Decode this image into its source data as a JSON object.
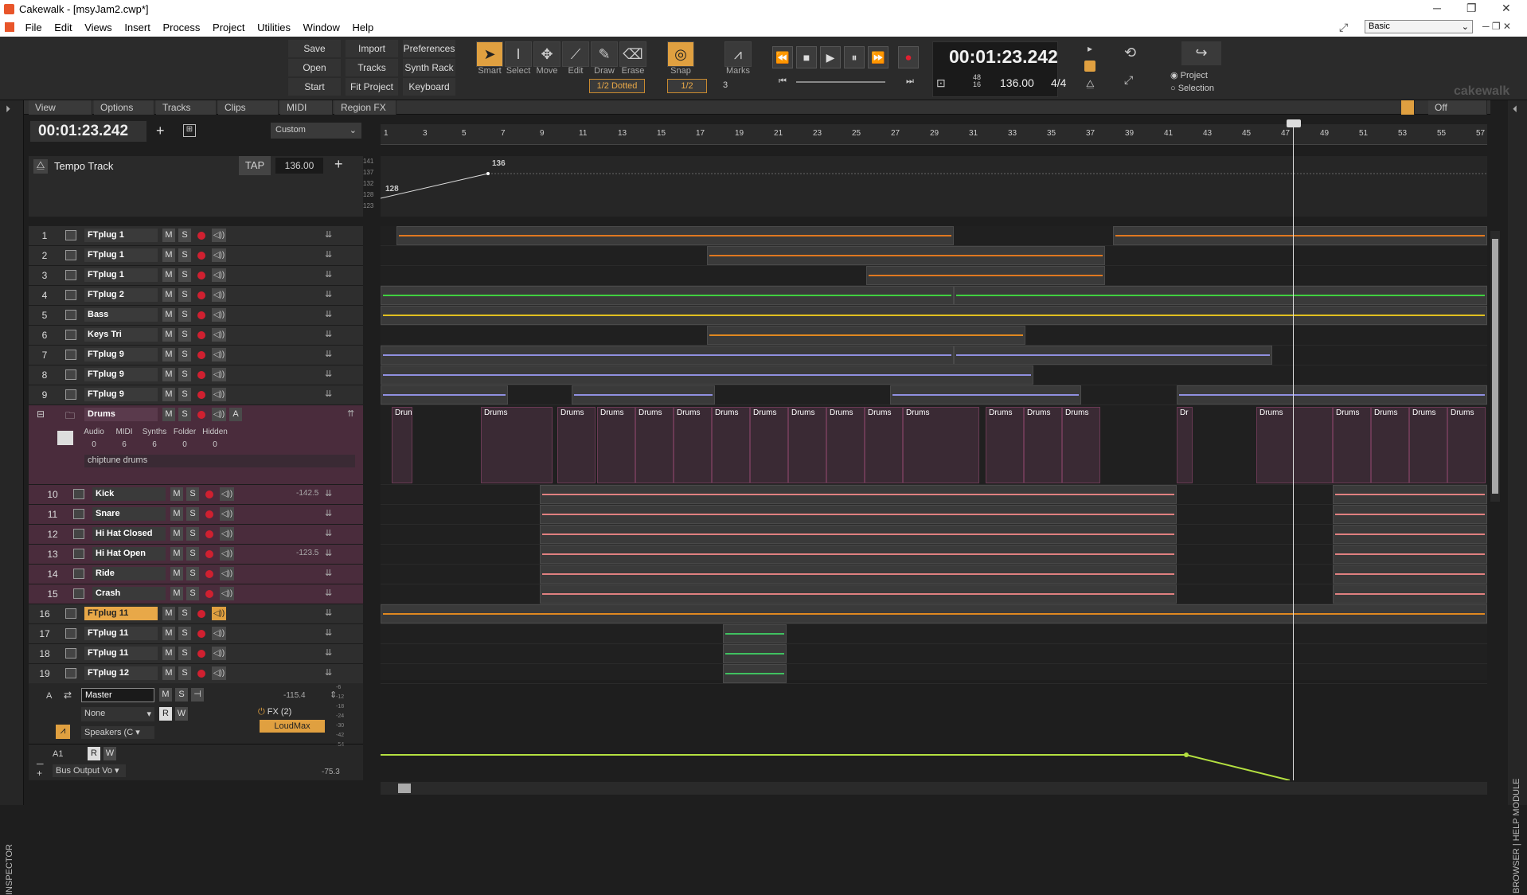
{
  "window": {
    "title": "Cakewalk - [msyJam2.cwp*]"
  },
  "menu": [
    "File",
    "Edit",
    "Views",
    "Insert",
    "Process",
    "Project",
    "Utilities",
    "Window",
    "Help"
  ],
  "workspace": "Basic",
  "control_bar": {
    "buttons": [
      "Save",
      "Import",
      "Preferences",
      "Open",
      "Tracks",
      "Synth Rack",
      "Start Screen",
      "Fit Project",
      "Keyboard"
    ],
    "tools": [
      "Smart",
      "Select",
      "Move",
      "Edit",
      "Draw",
      "Erase"
    ],
    "snap_label": "Snap",
    "snap_value": "1/2 Dotted",
    "marks_label": "Marks",
    "snap2_value": "1/2",
    "snap2_count": "3",
    "time": "00:01:23.242",
    "tempo": "136.00",
    "meter": "4/4",
    "ts_top": "48",
    "ts_bottom": "16",
    "project_opt": "Project",
    "selection_opt": "Selection"
  },
  "track_menu": [
    "View",
    "Options",
    "Tracks",
    "Clips",
    "MIDI",
    "Region FX"
  ],
  "region_off": "Off",
  "now_time": "00:01:23.242",
  "custom": "Custom",
  "tempo_track": {
    "label": "Tempo Track",
    "tap": "TAP",
    "value": "136.00",
    "start_val": "128",
    "end_val": "136",
    "scale": [
      "141",
      "137",
      "132",
      "128",
      "123"
    ]
  },
  "ruler": [
    "1",
    "3",
    "5",
    "7",
    "9",
    "11",
    "13",
    "15",
    "17",
    "19",
    "21",
    "23",
    "25",
    "27",
    "29",
    "31",
    "33",
    "35",
    "37",
    "39",
    "41",
    "43",
    "45",
    "47",
    "49",
    "51",
    "53",
    "55",
    "57"
  ],
  "tracks": [
    {
      "num": "1",
      "name": "FTplug 1"
    },
    {
      "num": "2",
      "name": "FTplug 1"
    },
    {
      "num": "3",
      "name": "FTplug 1"
    },
    {
      "num": "4",
      "name": "FTplug 2"
    },
    {
      "num": "5",
      "name": "Bass"
    },
    {
      "num": "6",
      "name": "Keys Tri"
    },
    {
      "num": "7",
      "name": "FTplug 9"
    },
    {
      "num": "8",
      "name": "FTplug 9"
    },
    {
      "num": "9",
      "name": "FTplug 9"
    }
  ],
  "folder": {
    "name": "Drums",
    "cols": [
      "Audio",
      "MIDI",
      "Synths",
      "Folder",
      "Hidden"
    ],
    "vals": [
      "0",
      "6",
      "6",
      "0",
      "0"
    ],
    "desc": "chiptune drums",
    "clip": "Drums",
    "clip_short": "Drun",
    "clip_dr": "Dr"
  },
  "drum_tracks": [
    {
      "num": "10",
      "name": "Kick",
      "vol": "-142.5"
    },
    {
      "num": "11",
      "name": "Snare",
      "vol": ""
    },
    {
      "num": "12",
      "name": "Hi Hat Closed",
      "vol": ""
    },
    {
      "num": "13",
      "name": "Hi Hat Open",
      "vol": "-123.5"
    },
    {
      "num": "14",
      "name": "Ride",
      "vol": ""
    },
    {
      "num": "15",
      "name": "Crash",
      "vol": ""
    }
  ],
  "tracks2": [
    {
      "num": "16",
      "name": "FTplug 11"
    },
    {
      "num": "17",
      "name": "FTplug 11"
    },
    {
      "num": "18",
      "name": "FTplug 11"
    },
    {
      "num": "19",
      "name": "FTplug 12"
    }
  ],
  "bus": {
    "letter": "A",
    "name": "Master",
    "vol": "-115.4",
    "input": "None",
    "fx": "FX (2)",
    "plugin": "LoudMax",
    "output": "Speakers (C",
    "auto": "A1",
    "env": "Bus Output Vo",
    "env_val": "-75.3",
    "scale": [
      "-6",
      "-12",
      "-18",
      "-24",
      "-30",
      "-42",
      "-54"
    ]
  },
  "side": {
    "inspector": "INSPECTOR",
    "browser": "BROWSER | HELP MODULE"
  },
  "logo": "cakewalk"
}
